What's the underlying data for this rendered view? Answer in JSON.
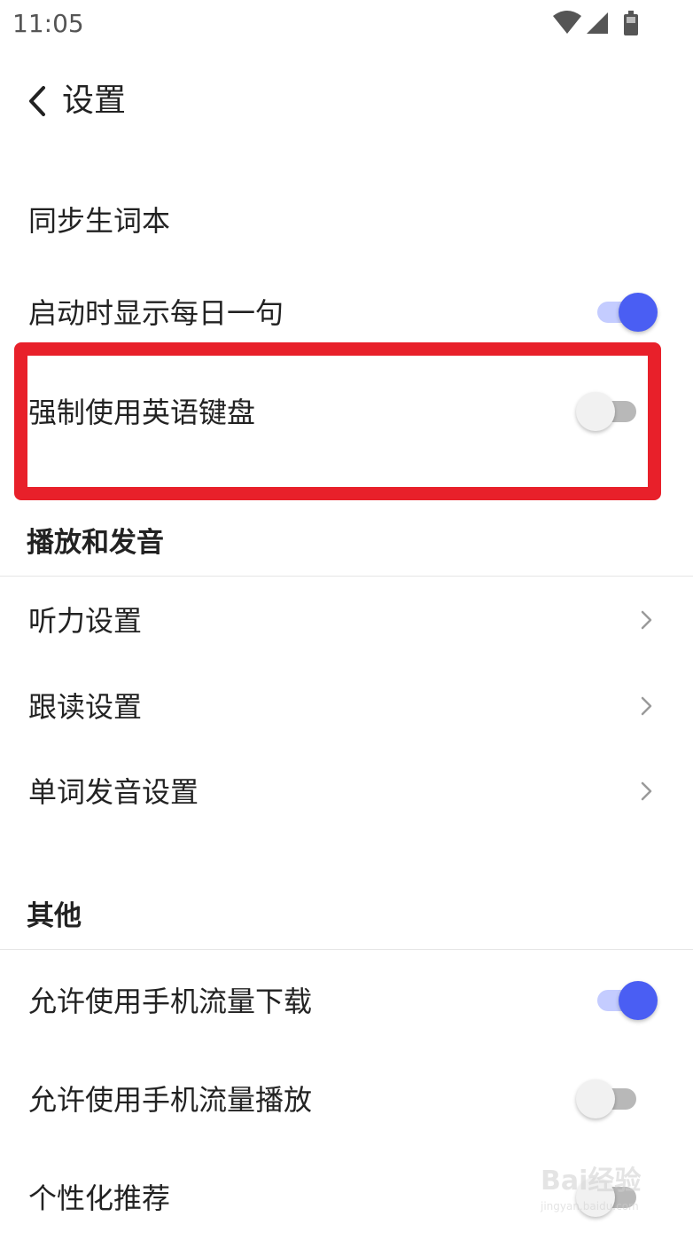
{
  "status_bar": {
    "time": "11:05"
  },
  "header": {
    "title": "设置"
  },
  "general": {
    "sync_vocab": "同步生词本",
    "daily_sentence": {
      "label": "启动时显示每日一句",
      "enabled": true
    },
    "force_english_keyboard": {
      "label": "强制使用英语键盘",
      "enabled": false
    }
  },
  "playback_section": {
    "title": "播放和发音",
    "items": [
      {
        "label": "听力设置"
      },
      {
        "label": "跟读设置"
      },
      {
        "label": "单词发音设置"
      }
    ]
  },
  "other_section": {
    "title": "其他",
    "mobile_download": {
      "label": "允许使用手机流量下载",
      "enabled": true
    },
    "mobile_playback": {
      "label": "允许使用手机流量播放",
      "enabled": false
    },
    "personalized": {
      "label": "个性化推荐",
      "enabled": false
    }
  },
  "colors": {
    "accent": "#4a5ef3",
    "highlight": "#e8202a"
  },
  "watermark": {
    "text_main": "Bai经验",
    "text_sub": "jingyan.baidu.com"
  }
}
